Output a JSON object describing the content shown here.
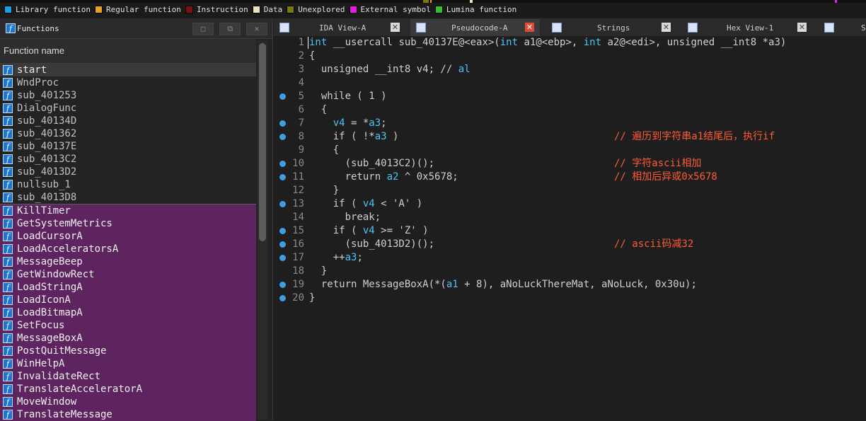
{
  "legend": [
    {
      "label": "Library function",
      "color": "#18a0e8"
    },
    {
      "label": "Regular function",
      "color": "#e8a020"
    },
    {
      "label": "Instruction",
      "color": "#7a1010"
    },
    {
      "label": "Data",
      "color": "#e8e4c0"
    },
    {
      "label": "Unexplored",
      "color": "#7a7a10"
    },
    {
      "label": "External symbol",
      "color": "#e818e0"
    },
    {
      "label": "Lumina function",
      "color": "#30c030"
    }
  ],
  "functions_panel": {
    "title": "Functions",
    "column_header": "Function name",
    "items": [
      {
        "name": "start",
        "kind": "sel"
      },
      {
        "name": "WndProc",
        "kind": "reg"
      },
      {
        "name": "sub_401253",
        "kind": "reg"
      },
      {
        "name": "DialogFunc",
        "kind": "reg"
      },
      {
        "name": "sub_40134D",
        "kind": "reg"
      },
      {
        "name": "sub_401362",
        "kind": "reg"
      },
      {
        "name": "sub_40137E",
        "kind": "reg"
      },
      {
        "name": "sub_4013C2",
        "kind": "reg"
      },
      {
        "name": "sub_4013D2",
        "kind": "reg"
      },
      {
        "name": "nullsub_1",
        "kind": "reg"
      },
      {
        "name": "sub_4013D8",
        "kind": "reg"
      },
      {
        "name": "KillTimer",
        "kind": "ext"
      },
      {
        "name": "GetSystemMetrics",
        "kind": "ext"
      },
      {
        "name": "LoadCursorA",
        "kind": "ext"
      },
      {
        "name": "LoadAcceleratorsA",
        "kind": "ext"
      },
      {
        "name": "MessageBeep",
        "kind": "ext"
      },
      {
        "name": "GetWindowRect",
        "kind": "ext"
      },
      {
        "name": "LoadStringA",
        "kind": "ext"
      },
      {
        "name": "LoadIconA",
        "kind": "ext"
      },
      {
        "name": "LoadBitmapA",
        "kind": "ext"
      },
      {
        "name": "SetFocus",
        "kind": "ext"
      },
      {
        "name": "MessageBoxA",
        "kind": "ext"
      },
      {
        "name": "PostQuitMessage",
        "kind": "ext"
      },
      {
        "name": "WinHelpA",
        "kind": "ext"
      },
      {
        "name": "InvalidateRect",
        "kind": "ext"
      },
      {
        "name": "TranslateAcceleratorA",
        "kind": "ext"
      },
      {
        "name": "MoveWindow",
        "kind": "ext"
      },
      {
        "name": "TranslateMessage",
        "kind": "ext"
      }
    ]
  },
  "tabs": [
    {
      "label": "IDA View-A",
      "active": false
    },
    {
      "label": "Pseudocode-A",
      "active": true
    },
    {
      "label": "Strings",
      "active": false
    },
    {
      "label": "Hex View-1",
      "active": false
    },
    {
      "label": "S",
      "active": false
    }
  ],
  "code_lines": [
    {
      "n": "1",
      "dot": false,
      "html": "<span class=\"var\">int</span> __usercall sub_40137E@&lt;eax&gt;(<span class=\"var\">int</span> a1@&lt;ebp&gt;, <span class=\"var\">int</span> a2@&lt;edi&gt;, unsigned __int8 *a3)"
    },
    {
      "n": "2",
      "dot": false,
      "html": "{"
    },
    {
      "n": "3",
      "dot": false,
      "html": "  unsigned __int8 v4; // <span class=\"var\">al</span>"
    },
    {
      "n": "4",
      "dot": false,
      "html": ""
    },
    {
      "n": "5",
      "dot": true,
      "html": "  while ( 1 )"
    },
    {
      "n": "6",
      "dot": false,
      "html": "  {"
    },
    {
      "n": "7",
      "dot": true,
      "html": "    <span class=\"var\">v4</span> = *<span class=\"var\">a3</span>;"
    },
    {
      "n": "8",
      "dot": true,
      "html": "    if ( !*<span class=\"var\">a3</span> )",
      "comment": "// 遍历到字符串a1结尾后，执行if"
    },
    {
      "n": "9",
      "dot": false,
      "html": "    {"
    },
    {
      "n": "10",
      "dot": true,
      "html": "      (sub_4013C2)();",
      "comment": "// 字符ascii相加"
    },
    {
      "n": "11",
      "dot": true,
      "html": "      return <span class=\"var\">a2</span> ^ 0x5678;",
      "comment": "// 相加后异或0x5678"
    },
    {
      "n": "12",
      "dot": false,
      "html": "    }"
    },
    {
      "n": "13",
      "dot": true,
      "html": "    if ( <span class=\"var\">v4</span> &lt; 'A' )"
    },
    {
      "n": "14",
      "dot": false,
      "html": "      break;"
    },
    {
      "n": "15",
      "dot": true,
      "html": "    if ( <span class=\"var\">v4</span> &gt;= 'Z' )"
    },
    {
      "n": "16",
      "dot": true,
      "html": "      (sub_4013D2)();",
      "comment": "// ascii码减32"
    },
    {
      "n": "17",
      "dot": true,
      "html": "    ++<span class=\"var\">a3</span>;"
    },
    {
      "n": "18",
      "dot": false,
      "html": "  }"
    },
    {
      "n": "19",
      "dot": true,
      "html": "  return MessageBoxA(*(<span class=\"var\">a1</span> + 8), aNoLuckThereMat, aNoLuck, 0x30u);"
    },
    {
      "n": "20",
      "dot": true,
      "html": "}"
    }
  ]
}
